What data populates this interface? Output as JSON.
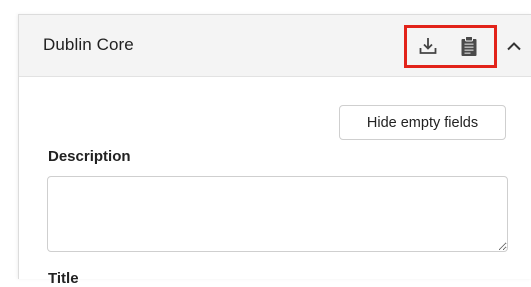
{
  "panel": {
    "title": "Dublin Core",
    "toolbar": {
      "download_icon": "download-icon",
      "clipboard_icon": "clipboard-icon",
      "collapse_icon": "chevron-up-icon",
      "highlight_color": "#e2231a"
    }
  },
  "actions": {
    "hide_empty_label": "Hide empty fields"
  },
  "fields": {
    "description": {
      "label": "Description",
      "value": "",
      "placeholder": ""
    },
    "title": {
      "label": "Title"
    }
  }
}
